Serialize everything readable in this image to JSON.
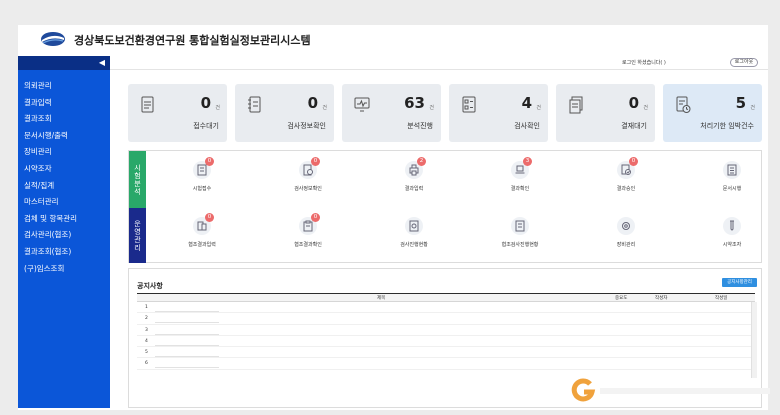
{
  "app": {
    "title": "경상북도보건환경연구원 통합실험실정보관리시스템",
    "collapse_icon": "◀"
  },
  "sidebar": {
    "items": [
      {
        "label": "의뢰관리"
      },
      {
        "label": "결과입력"
      },
      {
        "label": "결과조회"
      },
      {
        "label": "문서시행/출력"
      },
      {
        "label": "장비관리"
      },
      {
        "label": "시약조자"
      },
      {
        "label": "실적/집계"
      },
      {
        "label": "마스터관리"
      },
      {
        "label": "검체 및 항목관리"
      },
      {
        "label": "검사관리(협조)"
      },
      {
        "label": "결과조회(협조)"
      },
      {
        "label": "(구)임스조회"
      }
    ]
  },
  "topbar": {
    "login_text": "로그인 하셨습니다(                    )",
    "logout_label": "로그아웃"
  },
  "summary_cards": [
    {
      "value": "0",
      "unit": "건",
      "label": "접수대기",
      "icon": "document-icon"
    },
    {
      "value": "0",
      "unit": "건",
      "label": "검사정보확인",
      "icon": "notebook-icon"
    },
    {
      "value": "63",
      "unit": "건",
      "label": "분석진행",
      "icon": "monitor-icon"
    },
    {
      "value": "4",
      "unit": "건",
      "label": "검사확인",
      "icon": "checklist-icon"
    },
    {
      "value": "0",
      "unit": "건",
      "label": "결재대기",
      "icon": "papers-icon"
    },
    {
      "value": "5",
      "unit": "건",
      "label": "처리기한 임박건수",
      "icon": "clock-document-icon"
    }
  ],
  "panel": {
    "section1_label": "시험분석",
    "section2_label": "운영관리",
    "tiles_row1": [
      {
        "label": "시험접수",
        "badge": "0",
        "icon": "document-icon"
      },
      {
        "label": "검사정보확인",
        "badge": "0",
        "icon": "document-check-icon"
      },
      {
        "label": "결과입력",
        "badge": "2",
        "icon": "printer-icon"
      },
      {
        "label": "결과확인",
        "badge": "3",
        "icon": "laptop-icon"
      },
      {
        "label": "결과승인",
        "badge": "0",
        "icon": "approve-icon"
      },
      {
        "label": "문서시행",
        "badge": "",
        "icon": "list-icon"
      }
    ],
    "tiles_row2": [
      {
        "label": "협조결과입력",
        "badge": "0",
        "icon": "form-icon"
      },
      {
        "label": "협조결과확인",
        "badge": "0",
        "icon": "clipboard-icon"
      },
      {
        "label": "검사진행현황",
        "badge": "",
        "icon": "report-icon"
      },
      {
        "label": "협조검사진행현황",
        "badge": "",
        "icon": "report-list-icon"
      },
      {
        "label": "장비관리",
        "badge": "",
        "icon": "gear-icon"
      },
      {
        "label": "시약조자",
        "badge": "",
        "icon": "test-tube-icon"
      }
    ]
  },
  "notice": {
    "title": "공지사항",
    "all_button": "공지사항관리",
    "columns": [
      "제목",
      "중요도",
      "작성자",
      "작성일"
    ],
    "rows": [
      "1",
      "2",
      "3",
      "4",
      "5",
      "6"
    ]
  },
  "colors": {
    "sidebar": "#0b56d8",
    "sidebar_top": "#0a2f86",
    "tab_green": "#29a869",
    "tab_navy": "#1a2a8c",
    "badge": "#ec6b6b",
    "button": "#2f8fe0",
    "card_highlight": "#dde9f6"
  }
}
